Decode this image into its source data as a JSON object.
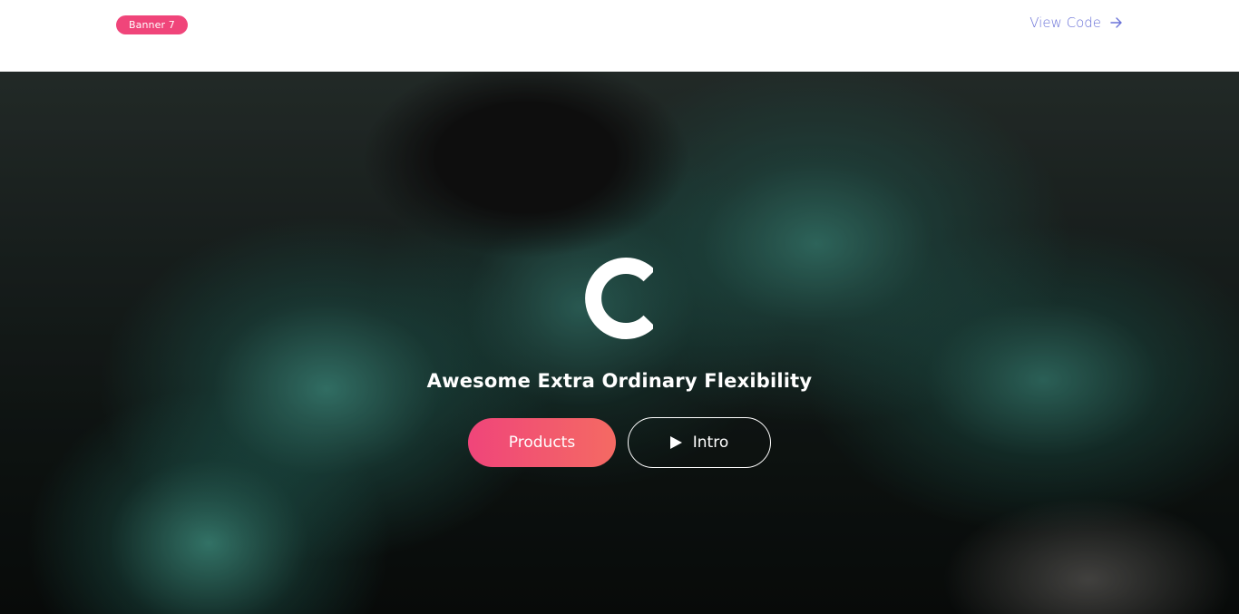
{
  "header": {
    "badge_label": "Banner 7",
    "view_code_label": "View Code"
  },
  "hero": {
    "logo_letter": "C",
    "tagline": "Awesome Extra Ordinary Flexibility",
    "primary_button_label": "Products",
    "secondary_button_label": "Intro"
  },
  "colors": {
    "accent_pink": "#f0457a",
    "accent_coral": "#f46a63",
    "link_blue": "#6a72d8",
    "smoke_teal": "#409687"
  },
  "icons": {
    "arrow": "arrow-right-icon",
    "play": "play-icon",
    "logo": "c-logo-icon"
  }
}
